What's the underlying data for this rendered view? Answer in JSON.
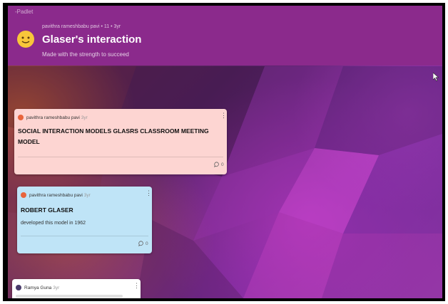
{
  "app": {
    "brand": "-Padlet"
  },
  "board": {
    "emoji": "smiling-face-emoji",
    "meta": "pavithra rameshbabu pavi  • 11  • 3yr",
    "title": "Glaser's interaction",
    "subtitle": "Made with the strength to succeed"
  },
  "posts": [
    {
      "author": "pavithra rameshbabu pavi",
      "time": "3yr",
      "title_line1": "SOCIAL INTERACTION MODELS GLASRS CLASSROOM MEETING",
      "title_line2": "MODEL",
      "comments": "0",
      "color": "#fdd5d2",
      "avatar_color": "#e8643c"
    },
    {
      "author": "pavithra rameshbabu pavi",
      "time": "3yr",
      "title": "ROBERT GLASER",
      "body": "developed this model in 1962",
      "comments": "0",
      "color": "#bfe4f7",
      "avatar_color": "#e8643c"
    },
    {
      "author": "Ramya Guna",
      "time": "3yr",
      "color": "#ffffff",
      "avatar_color": "#4a3b6b"
    }
  ],
  "icons": {
    "more": "more-vertical-icon",
    "comment": "comment-icon",
    "cursor": "mouse-cursor-icon"
  }
}
